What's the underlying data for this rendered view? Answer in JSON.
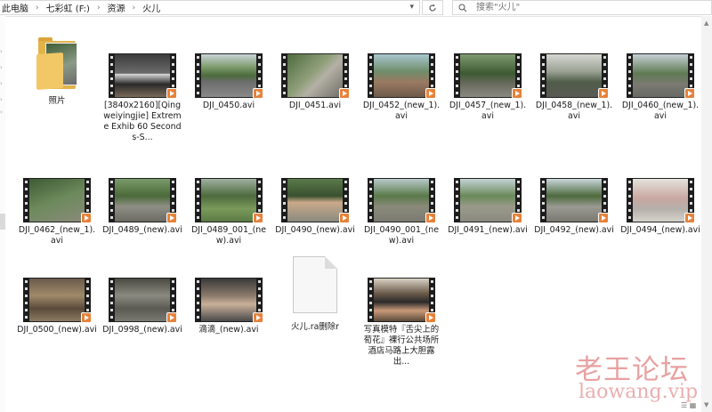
{
  "address": {
    "crumbs": [
      "此电脑",
      "七彩虹 (F:)",
      "资源",
      "火儿"
    ]
  },
  "search": {
    "placeholder": "搜索\"火儿\""
  },
  "icons": {
    "refresh": "refresh-icon",
    "search": "search-icon",
    "dropdown": "chevron-down-icon"
  },
  "colors": {
    "play_badge": "#e6823a",
    "folder": "#e3b34a",
    "watermark": "#e38a8a"
  },
  "items": [
    {
      "type": "folder",
      "name": "照片"
    },
    {
      "type": "video",
      "name": "[3840x2160][Qingweiyingjie] Extreme Exhib 60 Seconds-S..."
    },
    {
      "type": "video",
      "name": "DJI_0450.avi"
    },
    {
      "type": "video",
      "name": "DJI_0451.avi"
    },
    {
      "type": "video",
      "name": "DJI_0452_(new_1).avi"
    },
    {
      "type": "video",
      "name": "DJI_0457_(new_1).avi"
    },
    {
      "type": "video",
      "name": "DJI_0458_(new_1).avi"
    },
    {
      "type": "video",
      "name": "DJI_0460_(new_1).avi"
    },
    {
      "type": "video",
      "name": "DJI_0462_(new_1).avi"
    },
    {
      "type": "video",
      "name": "DJI_0489_(new).avi"
    },
    {
      "type": "video",
      "name": "DJI_0489_001_(new).avi"
    },
    {
      "type": "video",
      "name": "DJI_0490_(new).avi"
    },
    {
      "type": "video",
      "name": "DJI_0490_001_(new).avi"
    },
    {
      "type": "video",
      "name": "DJI_0491_(new).avi"
    },
    {
      "type": "video",
      "name": "DJI_0492_(new).avi"
    },
    {
      "type": "video",
      "name": "DJI_0494_(new).avi"
    },
    {
      "type": "video",
      "name": "DJI_0500_(new).avi"
    },
    {
      "type": "video",
      "name": "DJI_0998_(new).avi"
    },
    {
      "type": "video",
      "name": "滴滴_(new).avi"
    },
    {
      "type": "document",
      "name": "火儿.ra删除r"
    },
    {
      "type": "video",
      "name": "写真模特『舌尖上的荀花』裸行公共场所酒店马路上大胆露出..."
    }
  ],
  "watermark": {
    "cn": "老王论坛",
    "en": "laowang.vip"
  }
}
